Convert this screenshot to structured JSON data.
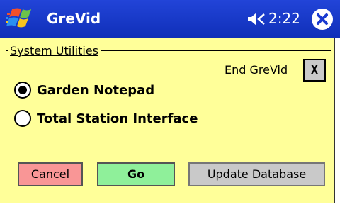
{
  "titlebar": {
    "app_title": "GreVid",
    "time": "2:22"
  },
  "group": {
    "legend": "System Utilities"
  },
  "end": {
    "label": "End GreVid",
    "button": "X"
  },
  "options": [
    {
      "label": "Garden Notepad",
      "selected": true
    },
    {
      "label": "Total Station Interface",
      "selected": false
    }
  ],
  "buttons": {
    "cancel": "Cancel",
    "go": "Go",
    "update": "Update Database"
  },
  "colors": {
    "titlebar": "#1a3ad0",
    "form_background": "#ffff99",
    "cancel": "#f99696",
    "go": "#8ff09a",
    "update": "#c9c9c9"
  },
  "icons": [
    "windows-start-icon",
    "speaker-icon",
    "close-icon"
  ]
}
